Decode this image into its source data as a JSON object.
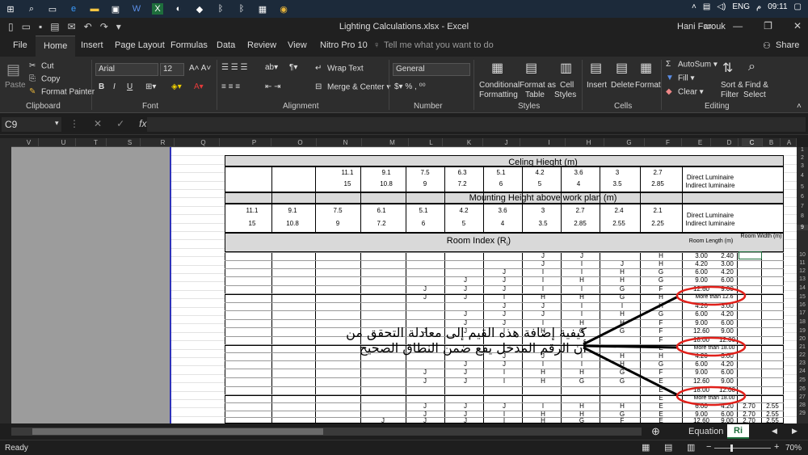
{
  "taskbar": {
    "lang": "ENG",
    "time": "09:11",
    "ampm": "م"
  },
  "window": {
    "title": "Lighting Calculations.xlsx - Excel",
    "user": "Hani Farouk"
  },
  "tabs": [
    "File",
    "Home",
    "Insert",
    "Page Layout",
    "Formulas",
    "Data",
    "Review",
    "View",
    "Nitro Pro 10"
  ],
  "tell_me": "Tell me what you want to do",
  "share": "Share",
  "ribbon": {
    "clipboard": {
      "label": "Clipboard",
      "paste": "Paste",
      "cut": "Cut",
      "copy": "Copy",
      "painter": "Format Painter"
    },
    "font": {
      "label": "Font",
      "name": "Arial",
      "size": "12"
    },
    "alignment": {
      "label": "Alignment",
      "wrap": "Wrap Text",
      "merge": "Merge & Center"
    },
    "number": {
      "label": "Number",
      "format": "General"
    },
    "styles": {
      "label": "Styles",
      "cond1": "Conditional",
      "cond2": "Formatting",
      "fmt1": "Format as",
      "fmt2": "Table",
      "cell1": "Cell",
      "cell2": "Styles"
    },
    "cells": {
      "label": "Cells",
      "insert": "Insert",
      "delete": "Delete",
      "format": "Format"
    },
    "editing": {
      "label": "Editing",
      "autosum": "AutoSum",
      "fill": "Fill",
      "clear": "Clear",
      "sort1": "Sort &",
      "sort2": "Filter",
      "find1": "Find &",
      "find2": "Select"
    }
  },
  "formula": {
    "namebox": "C9"
  },
  "columns": [
    "V",
    "U",
    "T",
    "S",
    "R",
    "Q",
    "P",
    "O",
    "N",
    "M",
    "L",
    "K",
    "J",
    "I",
    "H",
    "G",
    "F",
    "E",
    "D",
    "C",
    "B",
    "A"
  ],
  "rows": [
    "1",
    "2",
    "3",
    "4",
    "5",
    "6",
    "7",
    "8",
    "9",
    "10",
    "11",
    "12",
    "13",
    "14",
    "15",
    "16",
    "17",
    "18",
    "19",
    "20",
    "21",
    "22",
    "23",
    "24",
    "25",
    "26",
    "27",
    "28",
    "29"
  ],
  "table": {
    "ceiling_title": "Celing Hieght (m)",
    "ceiling_row1": [
      "11.1",
      "9.1",
      "7.5",
      "6.3",
      "5.1",
      "4.2",
      "3.6",
      "3",
      "2.7"
    ],
    "ceiling_row2": [
      "15",
      "10.8",
      "9",
      "7.2",
      "6",
      "5",
      "4",
      "3.5",
      "2.85"
    ],
    "direct": "Direct Luminaire",
    "indirect": "Indirect luminaire",
    "mounting_title": "Mounting Height above work plan (m)",
    "mount_row1": [
      "11.1",
      "9.1",
      "7.5",
      "6.1",
      "5.1",
      "4.2",
      "3.6",
      "3",
      "2.7",
      "2.4",
      "2.1"
    ],
    "mount_row2": [
      "15",
      "10.8",
      "9",
      "7.2",
      "6",
      "5",
      "4",
      "3.5",
      "2.85",
      "2.55",
      "2.25"
    ],
    "room_index": "Room Index (R",
    "room_index_sub": "i",
    "room_length": "Room Length (m)",
    "room_width": "Room Width (m)",
    "lengths": [
      "3.00",
      "4.20",
      "6.00",
      "9.00",
      "12.60",
      "More than 12.6",
      "4.20",
      "6.00",
      "9.00",
      "12.60",
      "18.00",
      "More than 18.00",
      "4.20",
      "6.00",
      "9.00",
      "12.60",
      "18.00",
      "More than 18.00",
      "6.00",
      "9.00",
      "12.60"
    ],
    "widths": [
      "2.40",
      "3.00",
      "4.20",
      "6.00",
      "9.00",
      "",
      "3.00",
      "4.20",
      "6.00",
      "9.00",
      "12.00",
      "",
      "3.00",
      "4.20",
      "6.00",
      "9.00",
      "12.00",
      "",
      "4.20",
      "6.00",
      "9.00"
    ],
    "extra_a": [
      "2.70",
      "2.70",
      "2.70"
    ],
    "extra_b": [
      "2.55",
      "2.55",
      "2.55"
    ],
    "letters_F": [
      "H",
      "H",
      "G",
      "G",
      "F",
      "H",
      "H",
      "G",
      "F",
      "F",
      "F",
      "E",
      "H",
      "G",
      "F",
      "E",
      "E",
      "E",
      "E",
      "E",
      "E"
    ],
    "letters_G": [
      "",
      "J",
      "H",
      "H",
      "G",
      "G",
      "I",
      "H",
      "H",
      "G",
      "",
      "",
      "H",
      "H",
      "G",
      "G",
      "",
      "",
      "H",
      "G",
      "F"
    ],
    "letters_H": [
      "J",
      "I",
      "I",
      "H",
      "I",
      "H",
      "I",
      "I",
      "H",
      "G",
      "",
      "",
      "I",
      "I",
      "H",
      "G",
      "",
      "",
      "H",
      "H",
      "G"
    ],
    "letters_I": [
      "J",
      "J",
      "I",
      "I",
      "I",
      "H",
      "J",
      "J",
      "I",
      "H",
      "",
      "",
      "J",
      "I",
      "H",
      "H",
      "",
      "",
      "I",
      "H",
      "H"
    ],
    "letters_J": [
      "",
      "",
      "J",
      "J",
      "J",
      "I",
      "J",
      "J",
      "J",
      "I",
      "",
      "",
      "J",
      "J",
      "I",
      "I",
      "",
      "",
      "J",
      "I",
      "I"
    ],
    "letters_K": [
      "",
      "",
      "",
      "J",
      "J",
      "J",
      "",
      "J",
      "J",
      "J",
      "",
      "",
      "",
      "J",
      "J",
      "J",
      "",
      "",
      "J",
      "J",
      "J"
    ],
    "letters_L": [
      "",
      "",
      "",
      "",
      "J",
      "J",
      "",
      "",
      "",
      "J",
      "",
      "",
      "",
      "",
      "J",
      "J",
      "",
      "",
      "J",
      "J",
      "J"
    ],
    "letters_N": [
      "",
      "",
      "",
      "",
      "",
      "",
      "",
      "",
      "",
      "",
      "",
      "",
      "",
      "",
      "",
      "",
      "",
      "",
      "",
      "",
      "J"
    ]
  },
  "annotation": {
    "line1": "كيفية إضافة هذه القيم إلى معادلة التحقق من",
    "line2": "أن الرقم المدخل يقع ضمن النطاق الصحيح"
  },
  "sheets": [
    "Equation",
    "Ri"
  ],
  "status": {
    "ready": "Ready",
    "zoom": "70%"
  },
  "colors": {
    "accent": "#1e6e3c",
    "circle": "#e0201a",
    "selection": "#2e32b8"
  }
}
